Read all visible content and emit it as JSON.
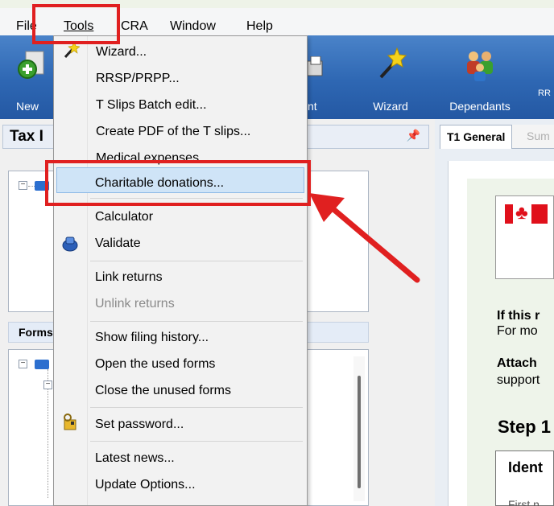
{
  "menubar": {
    "file": "File",
    "tools": "Tools",
    "cra": "CRA",
    "window": "Window",
    "help": "Help"
  },
  "toolbar": {
    "new_label": "New",
    "print_partial": "nt",
    "wizard_label": "Wizard",
    "dependants_label": "Dependants",
    "rr_partial": "RR"
  },
  "left_panel": {
    "tax_title": "Tax I",
    "forms_title": "Forms"
  },
  "right_panel": {
    "tab_active": "T1 General",
    "tab_inactive": "Sum",
    "if_this": "If this r",
    "for_more": "For mo",
    "attach": "Attach",
    "support": "support",
    "step": "Step 1",
    "ident": "Ident",
    "first": "First n"
  },
  "tools_menu": {
    "items": [
      {
        "label": "Wizard...",
        "icon": "wizard-wand-icon",
        "enabled": true
      },
      {
        "label": "RRSP/PRPP...",
        "enabled": true
      },
      {
        "label": "T Slips Batch edit...",
        "enabled": true
      },
      {
        "label": "Create PDF of the T slips...",
        "enabled": true
      },
      {
        "label": "Medical expenses...",
        "enabled": true
      },
      {
        "label": "Charitable donations...",
        "enabled": true,
        "highlighted": true
      },
      {
        "label": "Calculator",
        "enabled": true
      },
      {
        "label": "Validate",
        "icon": "validate-icon",
        "enabled": true
      },
      {
        "label": "Link returns",
        "enabled": true
      },
      {
        "label": "Unlink returns",
        "enabled": false
      },
      {
        "label": "Show filing history...",
        "enabled": true
      },
      {
        "label": "Open the used forms",
        "enabled": true
      },
      {
        "label": "Close the unused forms",
        "enabled": true
      },
      {
        "label": "Set password...",
        "icon": "password-key-icon",
        "enabled": true
      },
      {
        "label": "Latest news...",
        "enabled": true
      },
      {
        "label": "Update Options...",
        "enabled": true
      }
    ]
  },
  "colors": {
    "annotation_red": "#e02020",
    "toolbar_blue": "#2e67b3",
    "highlight": "#cfe4f7"
  }
}
